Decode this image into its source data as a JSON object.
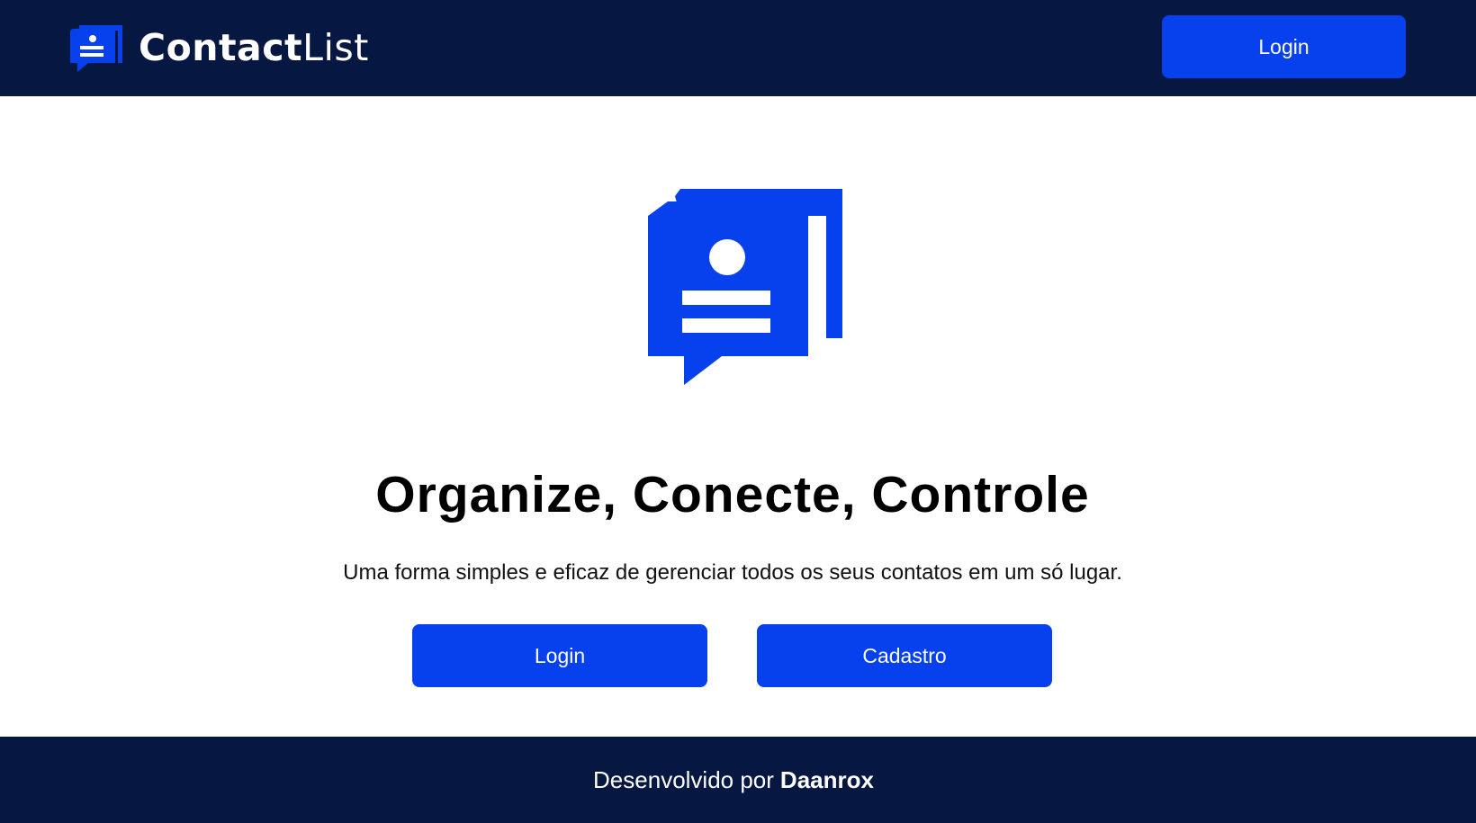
{
  "header": {
    "brand": {
      "name_bold": "Contact",
      "name_light": "List",
      "logo_icon": "contact-book-chat-icon"
    },
    "login_label": "Login"
  },
  "main": {
    "hero_icon": "contact-book-chat-icon",
    "headline": "Organize, Conecte, Controle",
    "subtitle": "Uma forma simples e eficaz de gerenciar todos os seus contatos em um só lugar.",
    "buttons": {
      "login_label": "Login",
      "register_label": "Cadastro"
    }
  },
  "footer": {
    "prefix": "Desenvolvido por",
    "author": "Daanrox"
  },
  "colors": {
    "navy": "#061741",
    "accent": "#0741ed",
    "white": "#ffffff",
    "text": "#000000"
  }
}
